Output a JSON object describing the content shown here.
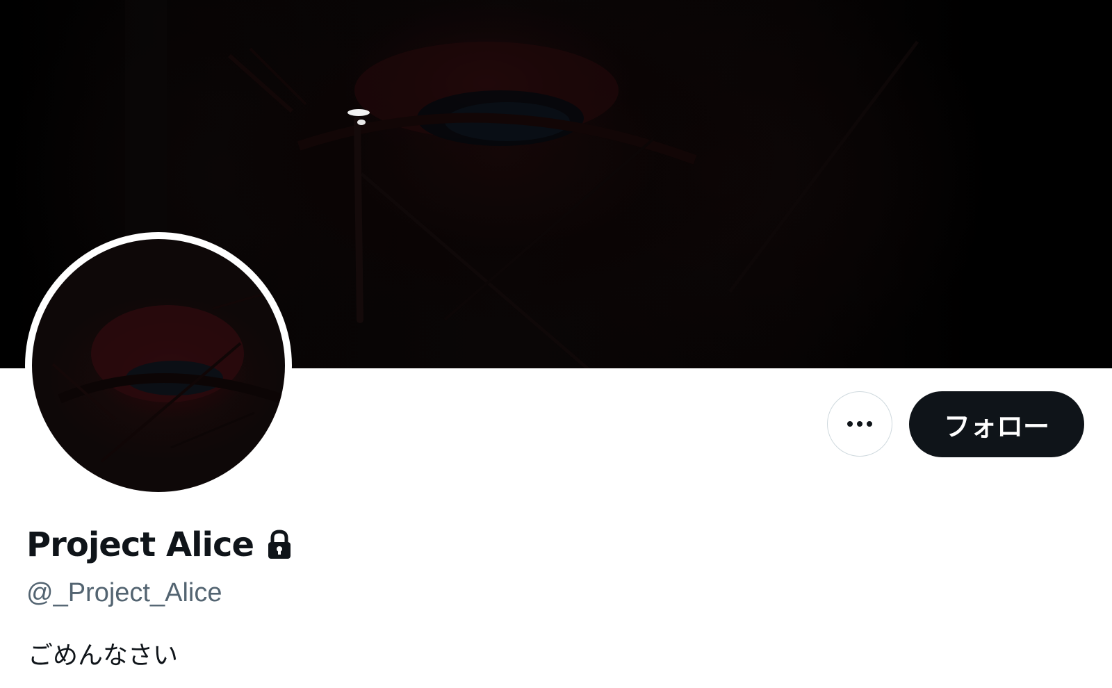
{
  "profile": {
    "display_name": "Project Alice",
    "handle": "@_Project_Alice",
    "bio": "ごめんなさい",
    "protected": true
  },
  "actions": {
    "follow_label": "フォロー",
    "more_icon": "more-horizontal-icon"
  },
  "icons": {
    "lock": "lock-icon"
  },
  "colors": {
    "primary_text": "#0f1419",
    "secondary_text": "#536471",
    "follow_button_bg": "#0f1419",
    "follow_button_text": "#ffffff",
    "outline": "#cfd9de",
    "banner_bg": "#000000"
  }
}
